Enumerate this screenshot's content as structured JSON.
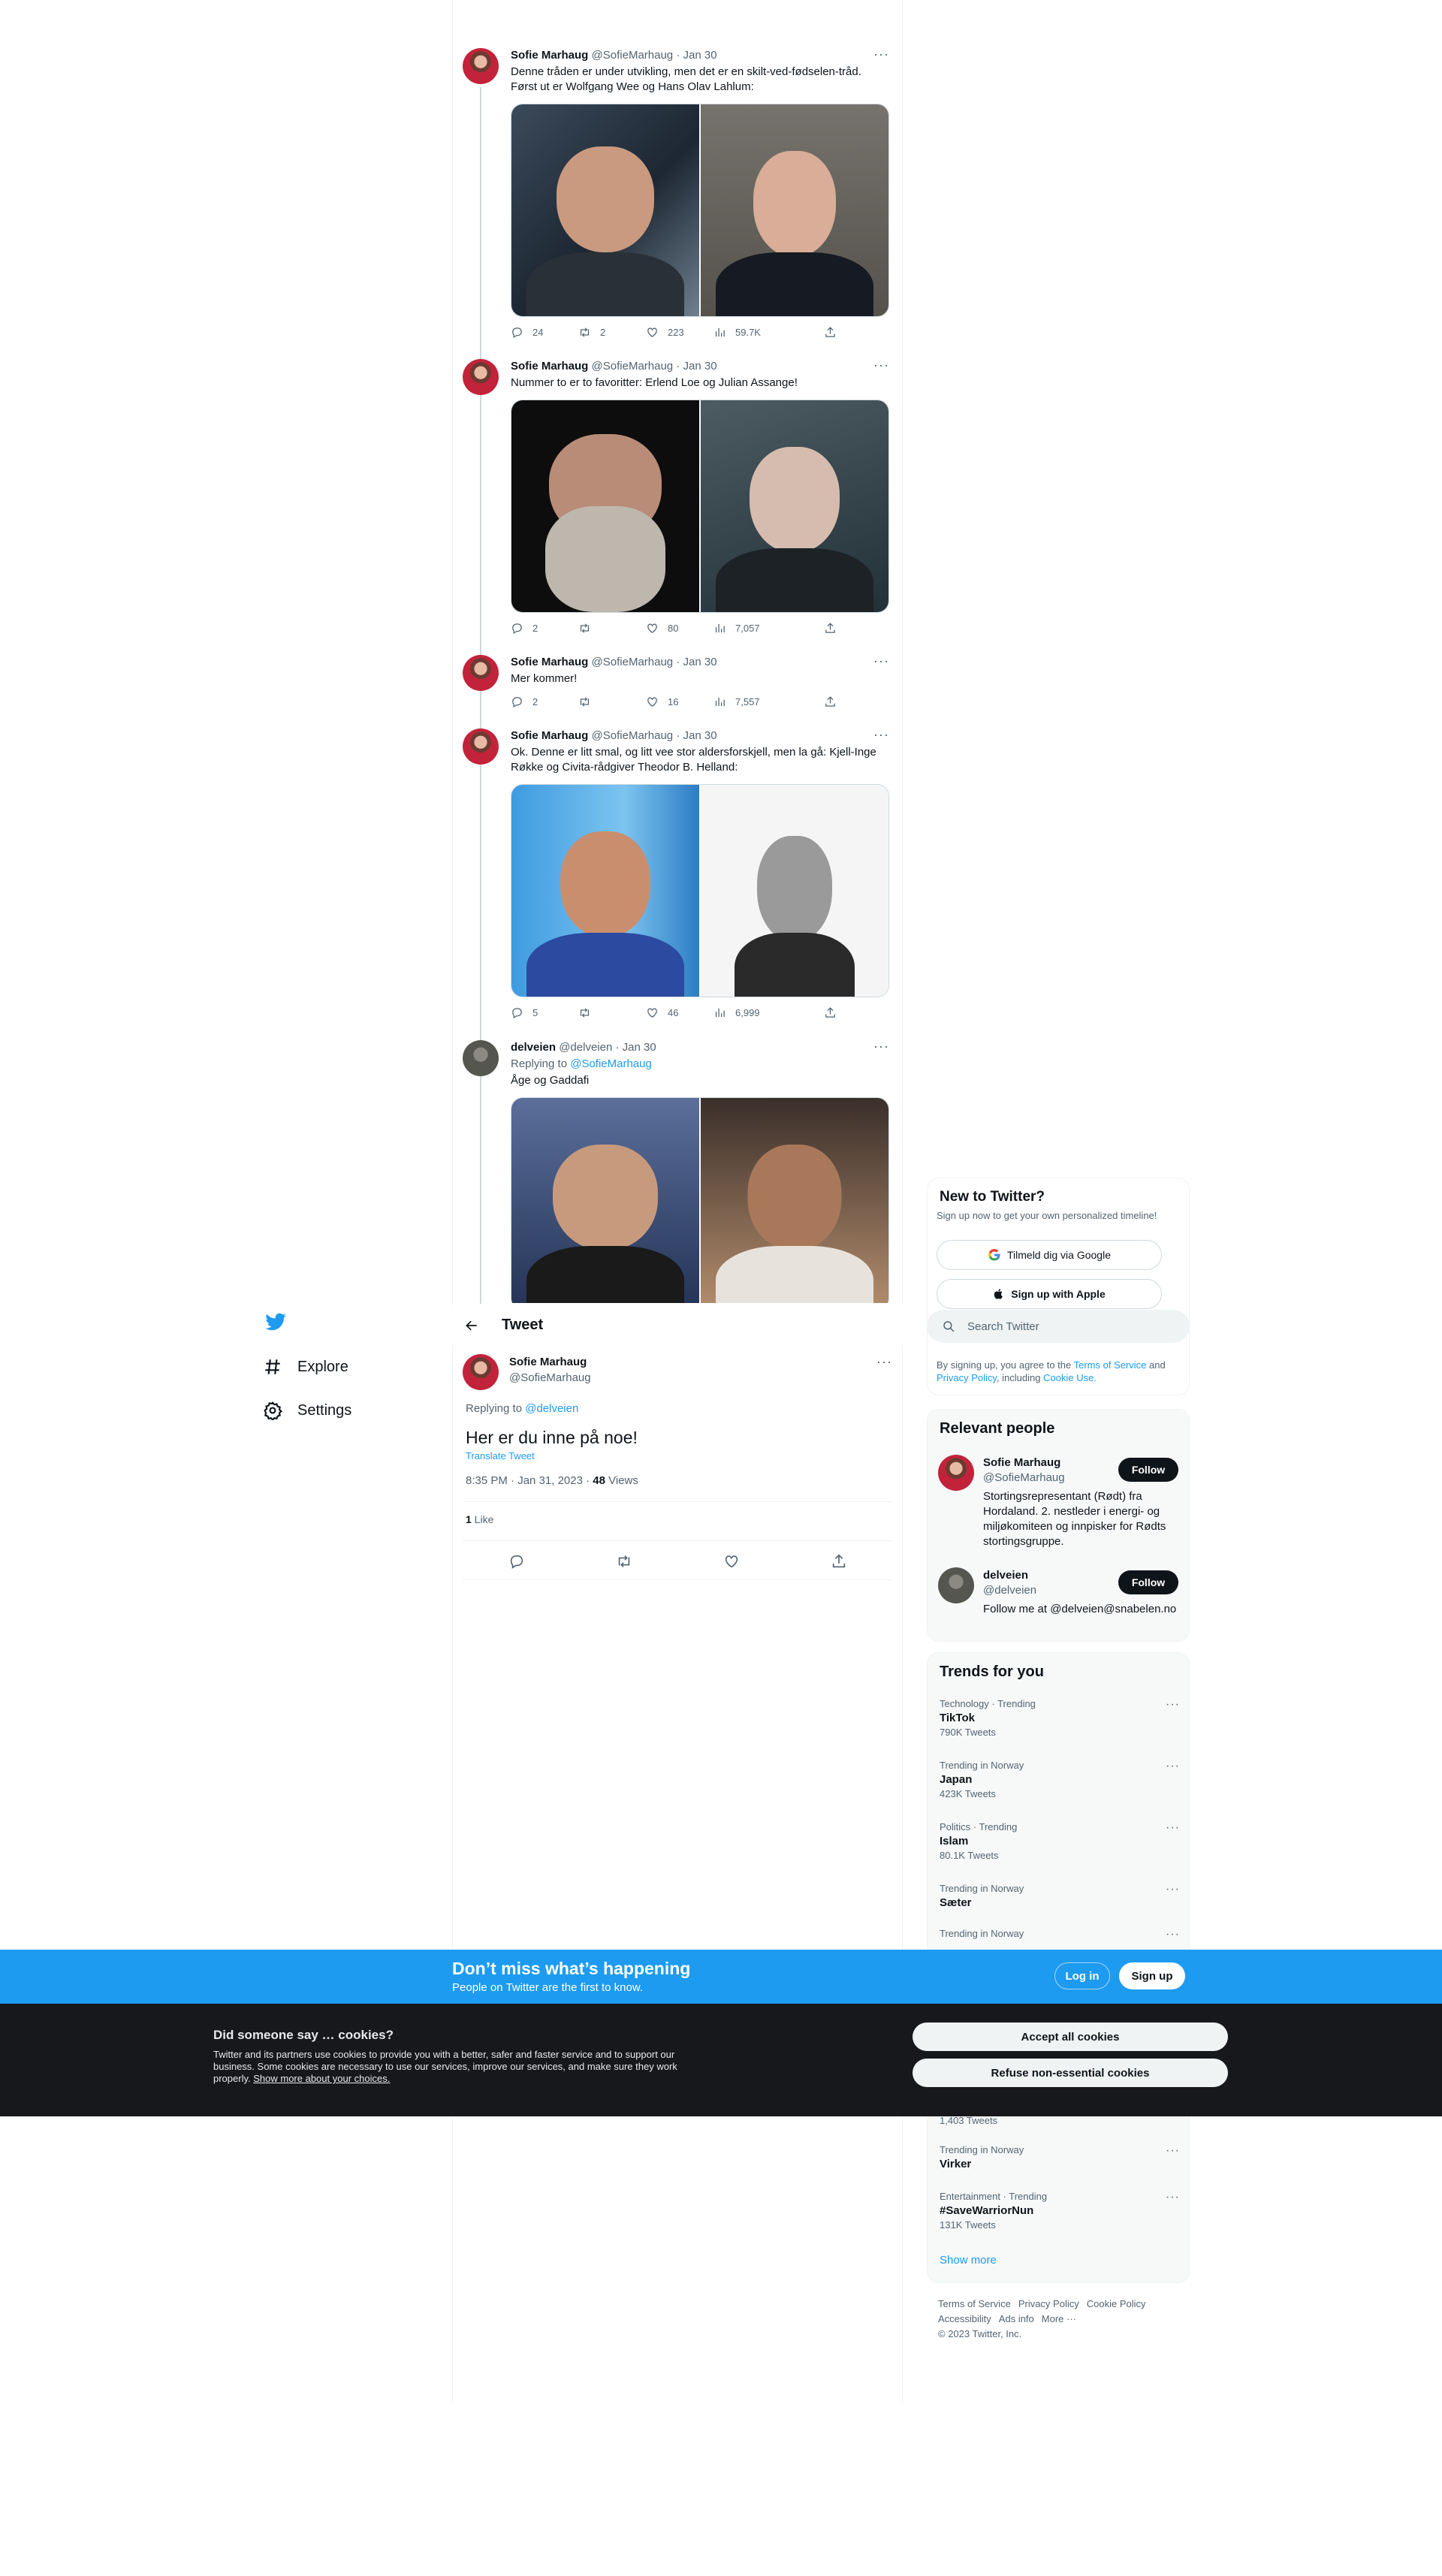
{
  "thread": [
    {
      "name": "Sofie Marhaug",
      "handle": "@SofieMarhaug",
      "date": "Jan 30",
      "text": "Denne tråden er under utvikling, men det er en skilt-ved-fødselen-tråd. Først ut er Wolfgang Wee og Hans Olav Lahlum:",
      "replies": "24",
      "retweets": "2",
      "likes": "223",
      "views": "59.7K"
    },
    {
      "name": "Sofie Marhaug",
      "handle": "@SofieMarhaug",
      "date": "Jan 30",
      "text": "Nummer to er to favoritter: Erlend Loe og Julian Assange!",
      "replies": "2",
      "retweets": "",
      "likes": "80",
      "views": "7,057"
    },
    {
      "name": "Sofie Marhaug",
      "handle": "@SofieMarhaug",
      "date": "Jan 30",
      "text": "Mer kommer!",
      "replies": "2",
      "retweets": "",
      "likes": "16",
      "views": "7,557"
    },
    {
      "name": "Sofie Marhaug",
      "handle": "@SofieMarhaug",
      "date": "Jan 30",
      "text": "Ok. Denne er litt smal, og litt vee stor aldersforskjell, men la gå: Kjell-Inge Røkke og Civita-rådgiver Theodor B. Helland:",
      "replies": "5",
      "retweets": "",
      "likes": "46",
      "views": "6,999"
    },
    {
      "name": "delveien",
      "handle": "@delveien",
      "date": "Jan 30",
      "replying_label": "Replying to",
      "replying_to": "@SofieMarhaug",
      "text": "Åge og Gaddafi"
    }
  ],
  "sep": " · ",
  "nav": {
    "explore": "Explore",
    "settings": "Settings"
  },
  "header": {
    "title": "Tweet"
  },
  "focus": {
    "name": "Sofie Marhaug",
    "handle": "@SofieMarhaug",
    "replying_label": "Replying to",
    "replying_to": "@delveien",
    "text": "Her er du inne på noe!",
    "translate": "Translate Tweet",
    "time": "8:35 PM · Jan 31, 2023 · ",
    "views_count": "48",
    "views_label": " Views",
    "likes_count": "1",
    "likes_label": " Like"
  },
  "new_to_twitter": {
    "title": "New to Twitter?",
    "subtitle": "Sign up now to get your own personalized timeline!",
    "google": "Tilmeld dig via Google",
    "apple": "Sign up with Apple",
    "terms_prefix": "By signing up, you agree to the ",
    "terms": "Terms of Service",
    "and": " and ",
    "privacy": "Privacy Policy",
    "including": ", including ",
    "cookie": "Cookie Use."
  },
  "search": {
    "placeholder": "Search Twitter"
  },
  "relevant": {
    "title": "Relevant people",
    "people": [
      {
        "name": "Sofie Marhaug",
        "handle": "@SofieMarhaug",
        "bio": "Stortingsrepresentant (Rødt) fra Hordaland. 2. nestleder i energi- og miljøkomiteen og innpisker for Rødts stortingsgruppe.",
        "follow": "Follow"
      },
      {
        "name": "delveien",
        "handle": "@delveien",
        "bio": "Follow me at @delveien@snabelen.no",
        "follow": "Follow"
      }
    ]
  },
  "trends": {
    "title": "Trends for you",
    "items": [
      {
        "context": "Technology · Trending",
        "name": "TikTok",
        "count": "790K Tweets"
      },
      {
        "context": "Trending in Norway",
        "name": "Japan",
        "count": "423K Tweets"
      },
      {
        "context": "Politics · Trending",
        "name": "Islam",
        "count": "80.1K Tweets"
      },
      {
        "context": "Trending in Norway",
        "name": "Sæter",
        "count": ""
      },
      {
        "context": "Trending in Norway",
        "name": "",
        "count": "1,403 Tweets"
      },
      {
        "context": "Trending in Norway",
        "name": "Virker",
        "count": ""
      },
      {
        "context": "Entertainment · Trending",
        "name": "#SaveWarriorNun",
        "count": "131K Tweets"
      }
    ],
    "show_more": "Show more"
  },
  "footer": {
    "tos": "Terms of Service",
    "privacy": "Privacy Policy",
    "cookie": "Cookie Policy",
    "accessibility": "Accessibility",
    "ads": "Ads info",
    "more": "More ···",
    "copyright": "© 2023 Twitter, Inc."
  },
  "banner": {
    "title": "Don’t miss what’s happening",
    "subtitle": "People on Twitter are the first to know.",
    "login": "Log in",
    "signup": "Sign up"
  },
  "cookies": {
    "title": "Did someone say … cookies?",
    "body": "Twitter and its partners use cookies to provide you with a better, safer and faster service and to support our business. Some cookies are necessary to use our services, improve our services, and make sure they work properly. ",
    "link": "Show more about your choices.",
    "accept": "Accept all cookies",
    "refuse": "Refuse non-essential cookies"
  },
  "colors": {
    "brand": "#1d9bf0",
    "text": "#0f1419",
    "muted": "#536471"
  }
}
